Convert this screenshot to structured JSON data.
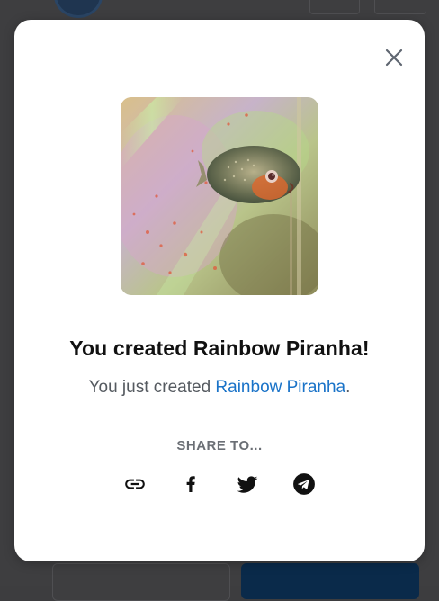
{
  "modal": {
    "title": "You created Rainbow Piranha!",
    "subtitle_prefix": "You just created ",
    "subtitle_link": "Rainbow Piranha",
    "subtitle_suffix": ".",
    "share_label": "SHARE TO...",
    "image_alt": "Rainbow Piranha artwork"
  },
  "share_options": [
    {
      "name": "copy-link",
      "icon": "link-icon"
    },
    {
      "name": "facebook",
      "icon": "facebook-icon"
    },
    {
      "name": "twitter",
      "icon": "twitter-icon"
    },
    {
      "name": "telegram",
      "icon": "telegram-icon"
    }
  ],
  "colors": {
    "link": "#1a73c8",
    "title": "#111111",
    "backdrop": "#3e3e40",
    "modal_bg": "#ffffff"
  }
}
